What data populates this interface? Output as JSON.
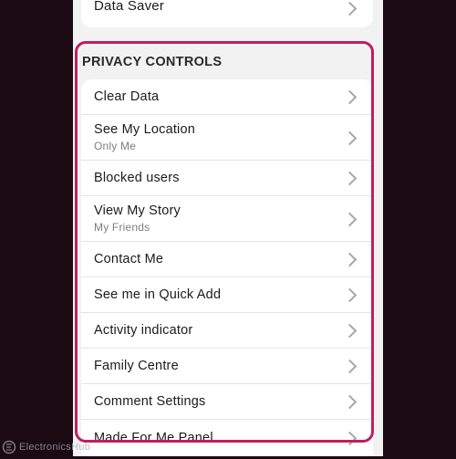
{
  "top_item": {
    "label": "Data Saver"
  },
  "section": {
    "title": "PRIVACY CONTROLS"
  },
  "items": [
    {
      "label": "Clear Data",
      "sub": ""
    },
    {
      "label": "See My Location",
      "sub": "Only Me"
    },
    {
      "label": "Blocked users",
      "sub": ""
    },
    {
      "label": "View My Story",
      "sub": "My Friends"
    },
    {
      "label": "Contact Me",
      "sub": ""
    },
    {
      "label": "See me in Quick Add",
      "sub": ""
    },
    {
      "label": "Activity indicator",
      "sub": ""
    },
    {
      "label": "Family Centre",
      "sub": ""
    },
    {
      "label": "Comment Settings",
      "sub": ""
    },
    {
      "label": "Made For Me Panel",
      "sub": ""
    }
  ],
  "watermark": {
    "text": "ElectronicsHub"
  },
  "colors": {
    "highlight": "#c01e5e",
    "background": "#1b0a12",
    "screen": "#f2f2f3",
    "chevron": "#a3a6ab"
  },
  "icons": {
    "chevron": "chevron-right-icon",
    "watermark_logo": "electronicshub-logo-icon"
  }
}
